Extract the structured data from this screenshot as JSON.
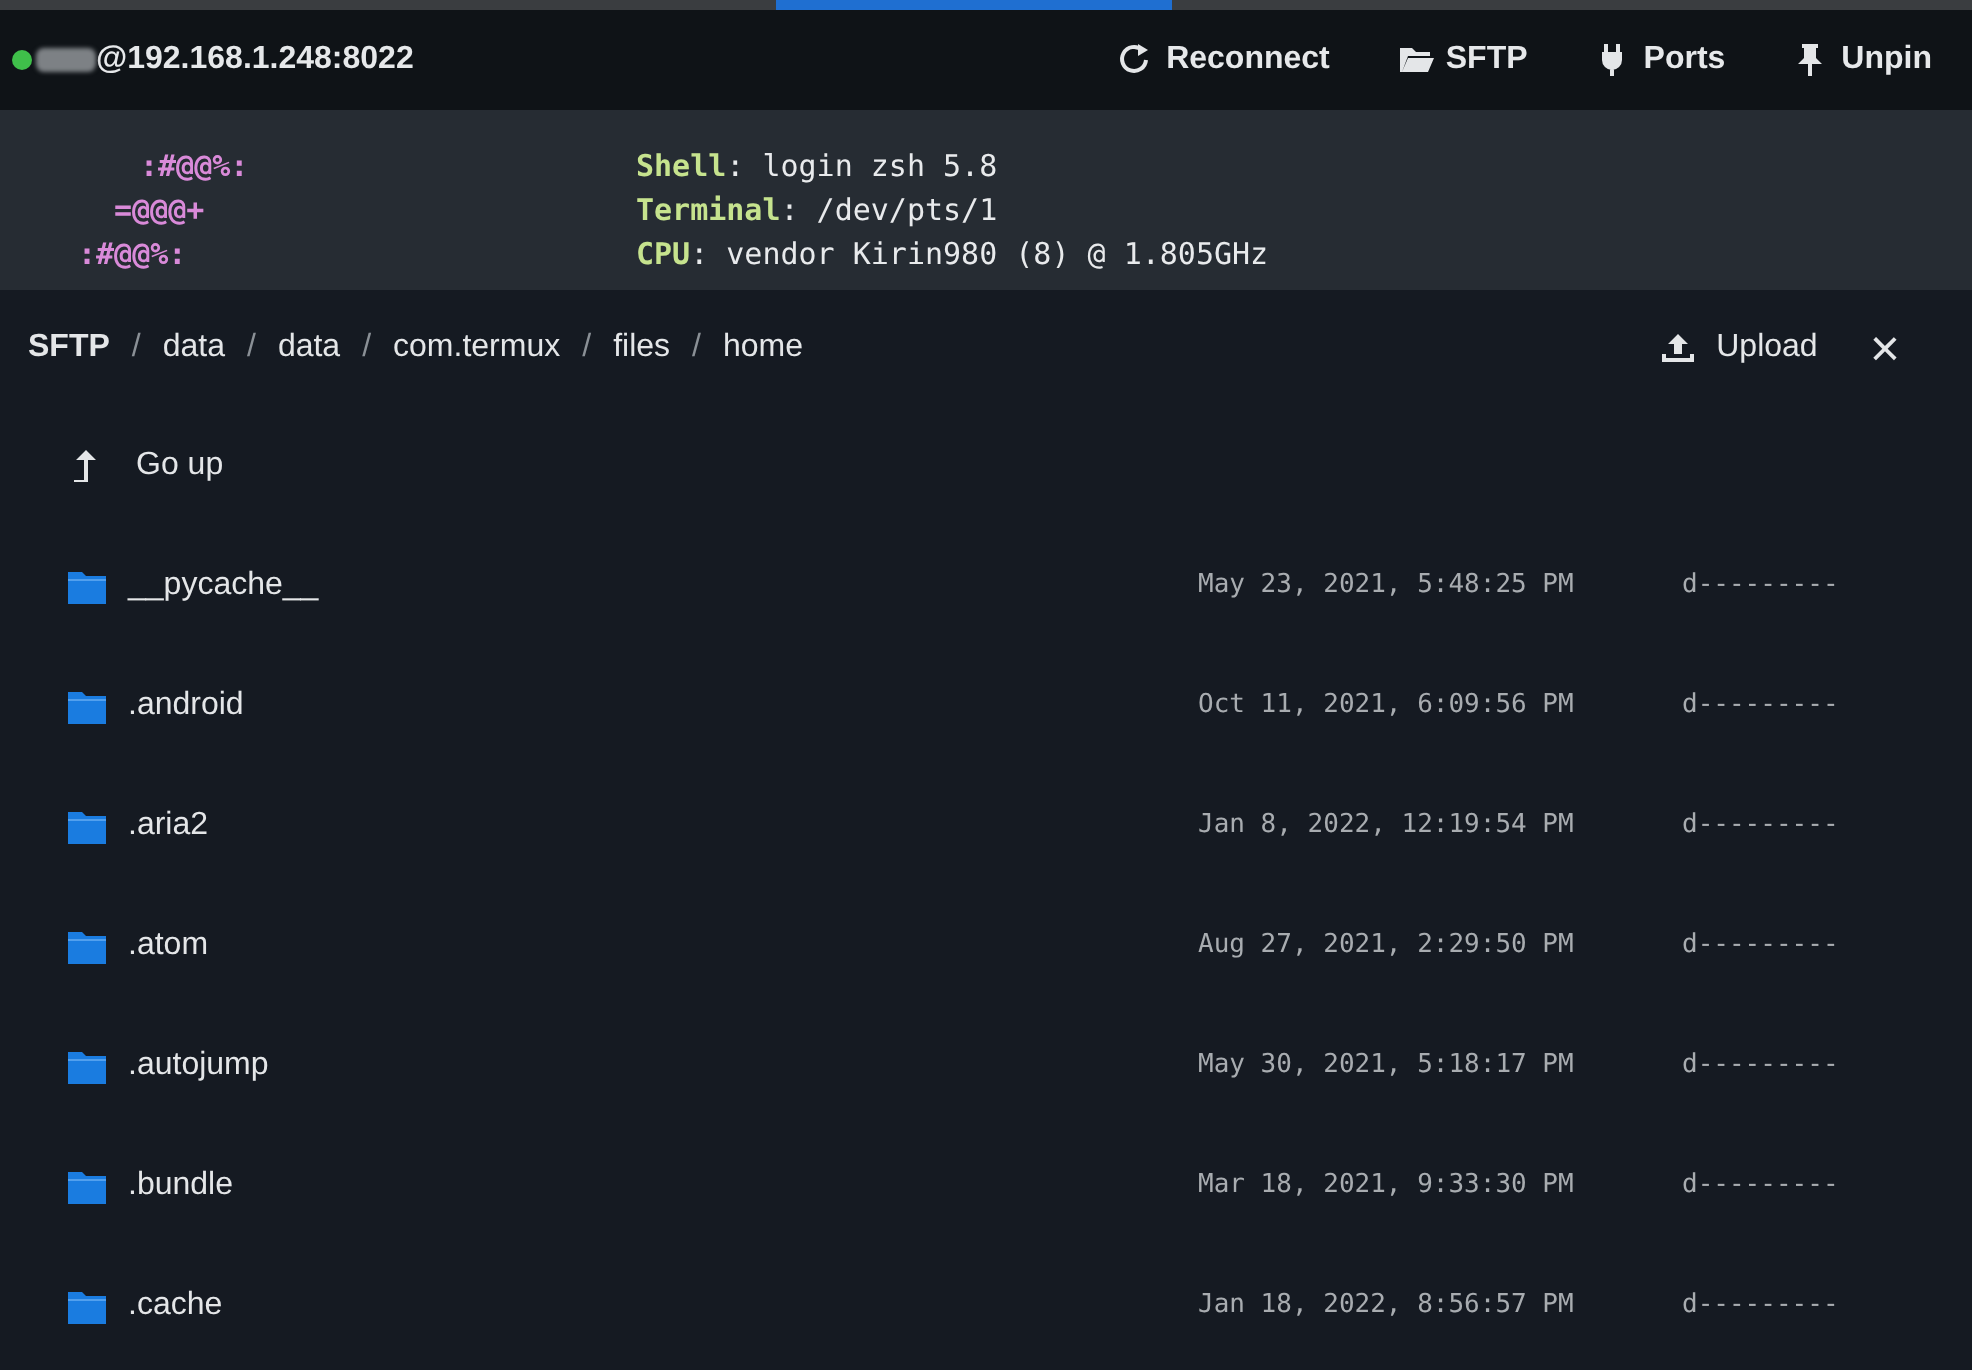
{
  "header": {
    "host": "@192.168.1.248:8022",
    "connected": true,
    "buttons": [
      {
        "kind": "reconnect",
        "label": "Reconnect"
      },
      {
        "kind": "sftp",
        "label": "SFTP"
      },
      {
        "kind": "ports",
        "label": "Ports"
      },
      {
        "kind": "pin",
        "label": "Unpin"
      }
    ]
  },
  "terminal": {
    "lines": [
      {
        "art": ":#@@%:",
        "label": "Shell",
        "value": ": login zsh 5.8"
      },
      {
        "art": "=@@@+",
        "label": "Terminal",
        "value": ": /dev/pts/1"
      },
      {
        "art": ":#@@%:",
        "label": "CPU",
        "value": ": vendor Kirin980 (8) @ 1.805GHz"
      }
    ]
  },
  "sftp": {
    "path_separator": "/",
    "path": [
      "SFTP",
      "data",
      "data",
      "com.termux",
      "files",
      "home"
    ],
    "upload": "Upload",
    "close": "×",
    "go_up": "Go up",
    "files": [
      {
        "name": "__pycache__",
        "modified": "May 23, 2021, 5:48:25 PM",
        "mode": "d---------"
      },
      {
        "name": ".android",
        "modified": "Oct 11, 2021, 6:09:56 PM",
        "mode": "d---------"
      },
      {
        "name": ".aria2",
        "modified": "Jan 8, 2022, 12:19:54 PM",
        "mode": "d---------"
      },
      {
        "name": ".atom",
        "modified": "Aug 27, 2021, 2:29:50 PM",
        "mode": "d---------"
      },
      {
        "name": ".autojump",
        "modified": "May 30, 2021, 5:18:17 PM",
        "mode": "d---------"
      },
      {
        "name": ".bundle",
        "modified": "Mar 18, 2021, 9:33:30 PM",
        "mode": "d---------"
      },
      {
        "name": ".cache",
        "modified": "Jan 18, 2022, 8:56:57 PM",
        "mode": "d---------"
      }
    ]
  }
}
